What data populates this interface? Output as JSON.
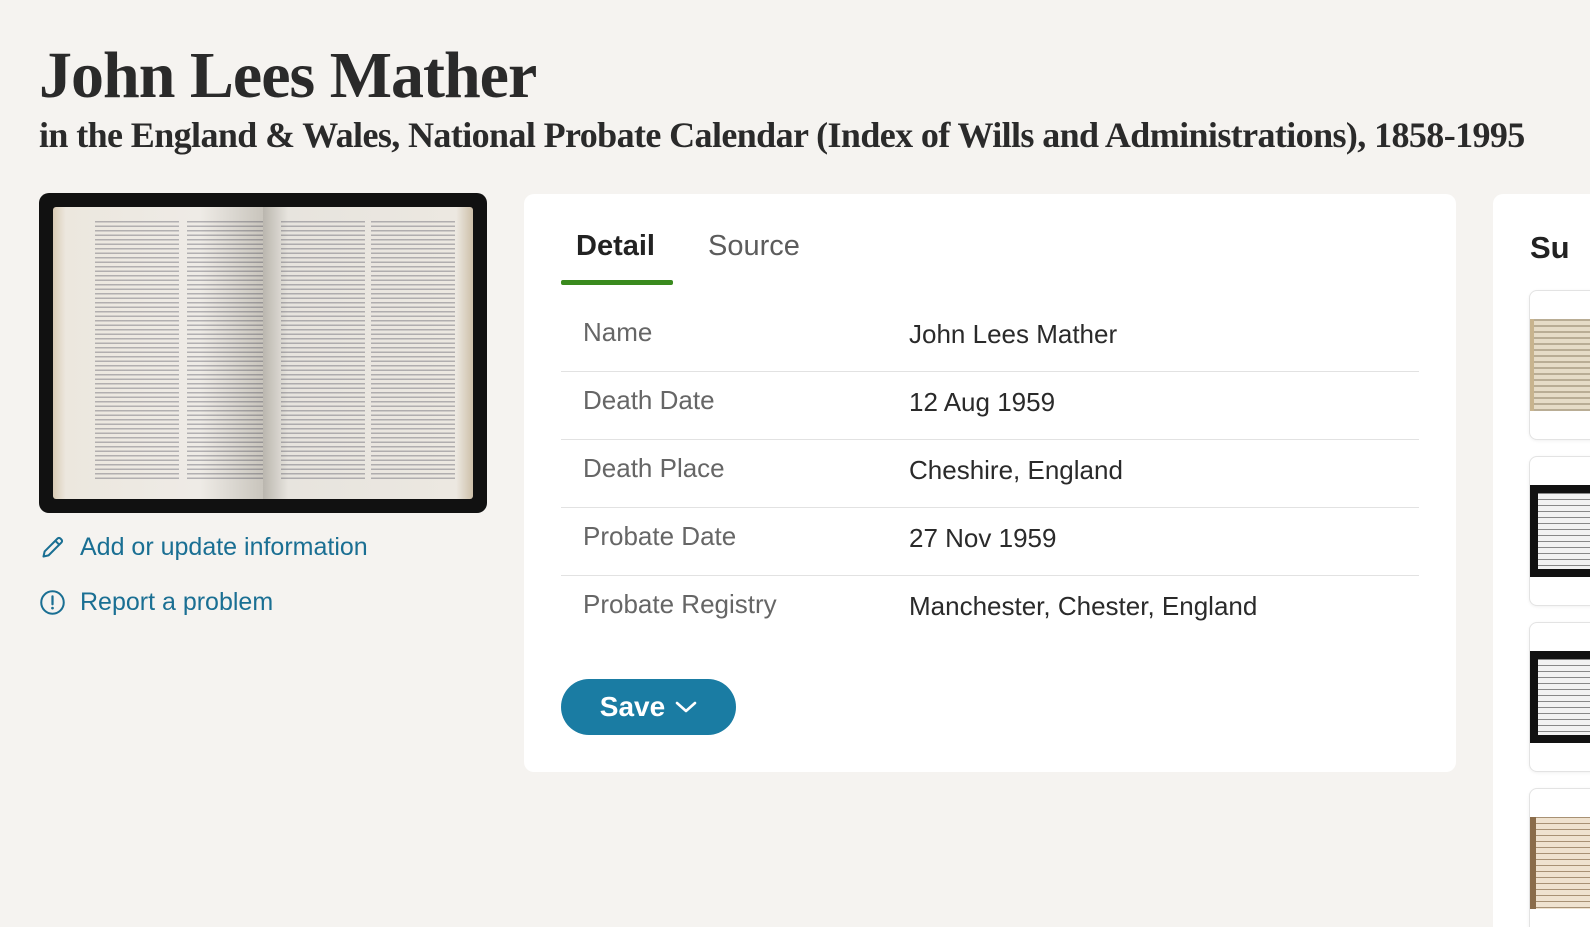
{
  "header": {
    "title": "John Lees Mather",
    "subtitle": "in the England & Wales, National Probate Calendar (Index of Wills and Administrations), 1858-1995"
  },
  "actions": {
    "add_update": "Add or update information",
    "report": "Report a problem"
  },
  "tabs": [
    {
      "label": "Detail",
      "active": true
    },
    {
      "label": "Source",
      "active": false
    }
  ],
  "details": [
    {
      "label": "Name",
      "value": "John Lees Mather"
    },
    {
      "label": "Death Date",
      "value": "12 Aug 1959"
    },
    {
      "label": "Death Place",
      "value": "Cheshire, England"
    },
    {
      "label": "Probate Date",
      "value": "27 Nov 1959"
    },
    {
      "label": "Probate Registry",
      "value": "Manchester, Chester, England"
    }
  ],
  "save_button": {
    "label": "Save"
  },
  "suggestions": {
    "title": "Su"
  },
  "colors": {
    "accent": "#1a7ca3",
    "link": "#1a6f93",
    "tab_underline": "#3a8a1e",
    "background": "#f5f3f0"
  }
}
